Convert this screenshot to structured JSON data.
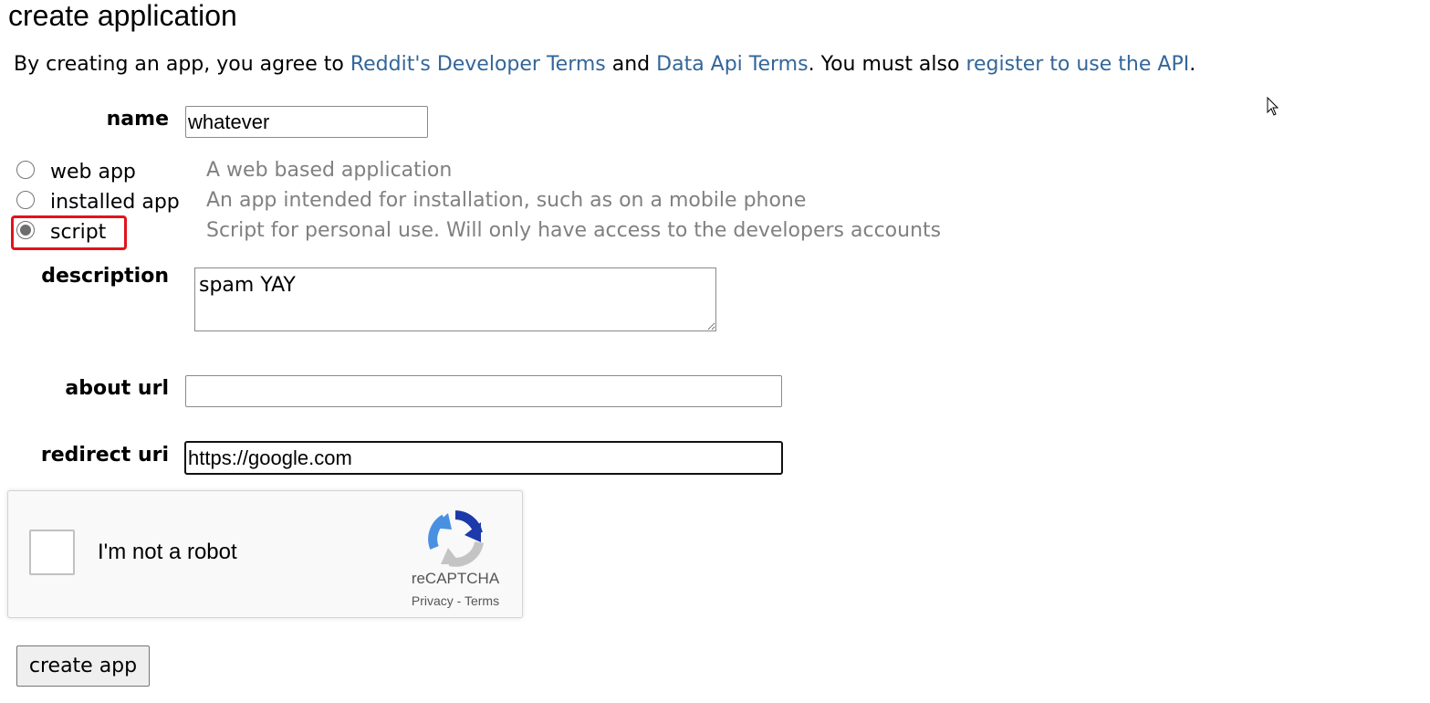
{
  "heading": "create application",
  "terms": {
    "prefix": "By creating an app, you agree to ",
    "link1": "Reddit's Developer Terms",
    "and": " and ",
    "link2": "Data Api Terms",
    "middle": ". You must also ",
    "link3": "register to use the API",
    "suffix": ".",
    "link_color": "#336699"
  },
  "form": {
    "name_label": "name",
    "name_value": "whatever",
    "app_types": [
      {
        "label": "web app",
        "description": "A web based application",
        "selected": false
      },
      {
        "label": "installed app",
        "description": "An app intended for installation, such as on a mobile phone",
        "selected": false
      },
      {
        "label": "script",
        "description": "Script for personal use. Will only have access to the developers accounts",
        "selected": true
      }
    ],
    "description_label": "description",
    "description_value": "spam YAY",
    "about_url_label": "about url",
    "about_url_value": "",
    "redirect_uri_label": "redirect uri",
    "redirect_uri_value": "https://google.com"
  },
  "captcha": {
    "label": "I'm not a robot",
    "brand": "reCAPTCHA",
    "privacy": "Privacy",
    "separator": " - ",
    "terms": "Terms",
    "checked": false
  },
  "submit_label": "create app",
  "highlight_color": "#e0141b",
  "icons": {
    "captcha_logo": "recaptcha-logo-icon",
    "cursor": "mouse-cursor-icon"
  }
}
